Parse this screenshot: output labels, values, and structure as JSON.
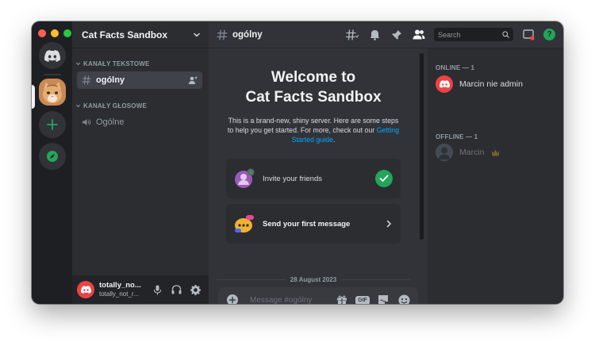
{
  "window": {
    "traffic_lights": [
      "#ff5f57",
      "#febc2e",
      "#28c840"
    ]
  },
  "server": {
    "name": "Cat Facts Sandbox"
  },
  "sidebar": {
    "text_category": "KANAŁY TEKSTOWE",
    "voice_category": "KANAŁY GŁOSOWE",
    "text_channel": "ogólny",
    "voice_channel": "Ogólne"
  },
  "user": {
    "name": "totally_no...",
    "tag": "totally_not_r..."
  },
  "topbar": {
    "channel": "ogólny",
    "search_placeholder": "Search",
    "help": "?"
  },
  "chat": {
    "welcome_line1": "Welcome to",
    "welcome_line2": "Cat Facts Sandbox",
    "desc_text": "This is a brand-new, shiny server. Here are some steps to help you get started. For more, check out our",
    "desc_link": "Getting Started guide",
    "desc_end": ".",
    "card_invite": "Invite your friends",
    "card_message": "Send your first message",
    "date": "28 August 2023",
    "composer_placeholder": "Message #ogólny",
    "gif_label": "GIF"
  },
  "members": {
    "online_header": "ONLINE — 1",
    "offline_header": "OFFLINE — 1",
    "online": [
      {
        "name": "Marcin nie admin"
      }
    ],
    "offline": [
      {
        "name": "Marcin"
      }
    ]
  },
  "colors": {
    "accent": "#5865f2",
    "online_green": "#23a55a",
    "link": "#00a8fc",
    "danger": "#ed4245"
  }
}
